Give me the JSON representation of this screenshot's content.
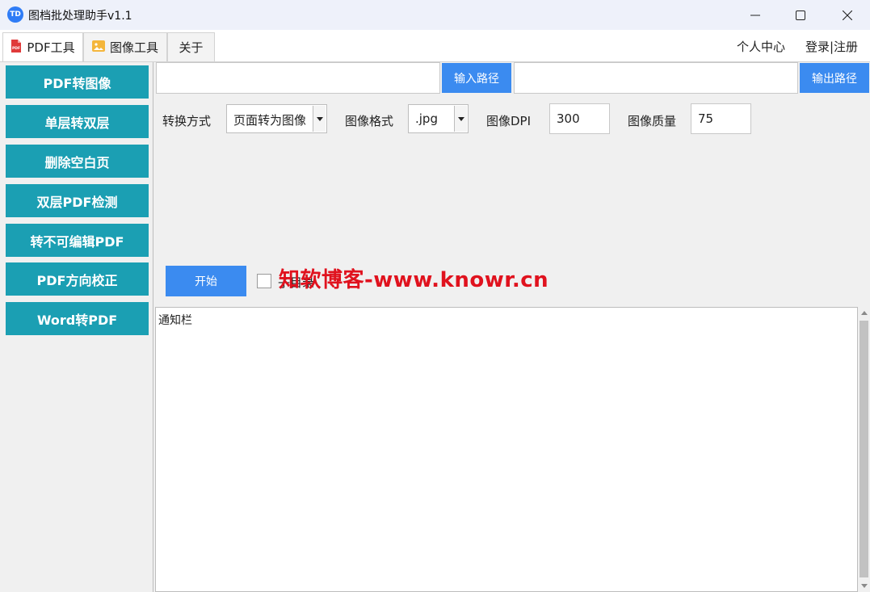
{
  "window": {
    "icon_text": "TD",
    "title": "图档批处理助手v1.1"
  },
  "tabs": [
    {
      "label": "PDF工具",
      "icon": "pdf-file-icon",
      "active": true
    },
    {
      "label": "图像工具",
      "icon": "image-file-icon",
      "active": false
    },
    {
      "label": "关于",
      "icon": "",
      "active": false
    }
  ],
  "top_links": {
    "user_center": "个人中心",
    "login": "登录|注册"
  },
  "sidebar": {
    "items": [
      {
        "label": "PDF转图像"
      },
      {
        "label": "单层转双层"
      },
      {
        "label": "删除空白页"
      },
      {
        "label": "双层PDF检测"
      },
      {
        "label": "转不可编辑PDF"
      },
      {
        "label": "PDF方向校正"
      },
      {
        "label": "Word转PDF"
      }
    ]
  },
  "paths": {
    "input_value": "",
    "input_button": "输入路径",
    "output_value": "",
    "output_button": "输出路径"
  },
  "options": {
    "mode_label": "转换方式",
    "mode_value": "页面转为图像",
    "format_label": "图像格式",
    "format_value": ".jpg",
    "dpi_label": "图像DPI",
    "dpi_value": "300",
    "quality_label": "图像质量",
    "quality_value": "75"
  },
  "actions": {
    "start_label": "开始",
    "checkbox_label": "子目录",
    "checkbox_checked": false
  },
  "watermark": "知软博客-www.knowr.cn",
  "notice": {
    "text": "通知栏"
  },
  "colors": {
    "sidebar_button": "#1b9fb3",
    "primary_button": "#3b8bf0",
    "watermark": "#e0121e",
    "app_icon": "#2f7cf6"
  }
}
